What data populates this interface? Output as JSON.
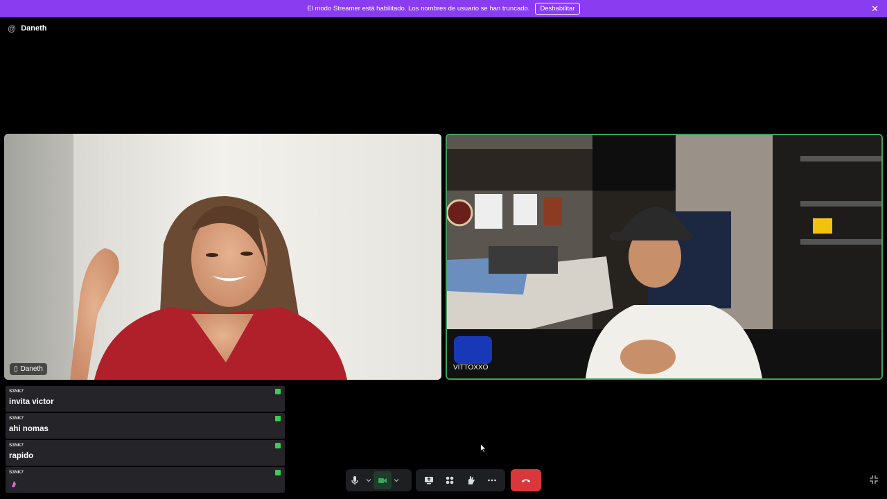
{
  "banner": {
    "message": "El modo Streamer está habilitado. Los nombres de usuario se han truncado.",
    "button_label": "Deshabilitar",
    "close_icon": "close-icon"
  },
  "channel": {
    "icon": "at-icon",
    "name": "Daneth"
  },
  "participants": [
    {
      "name": "Daneth",
      "device_icon": "mobile-icon",
      "speaking": false
    },
    {
      "name": "VITTOXXO",
      "speaking": true
    }
  ],
  "chat": [
    {
      "author": "S3NK7",
      "text": "invita victor"
    },
    {
      "author": "S3NK7",
      "text": "ahi nomas"
    },
    {
      "author": "S3NK7",
      "text": "rapido"
    },
    {
      "author": "S3NK7",
      "text": "",
      "emote": "emote-icon"
    }
  ],
  "controls": {
    "microphone": "microphone-icon",
    "camera": "camera-icon",
    "screen_share": "screen-share-icon",
    "activities": "activities-icon",
    "soundboard": "soundboard-icon",
    "more": "more-icon",
    "disconnect": "hang-up-icon",
    "fullscreen": "exit-fullscreen-icon"
  },
  "colors": {
    "banner": "#8a3cf0",
    "speaking_border": "#3ba55d",
    "hangup": "#da373c",
    "badge": "#35d04d"
  }
}
